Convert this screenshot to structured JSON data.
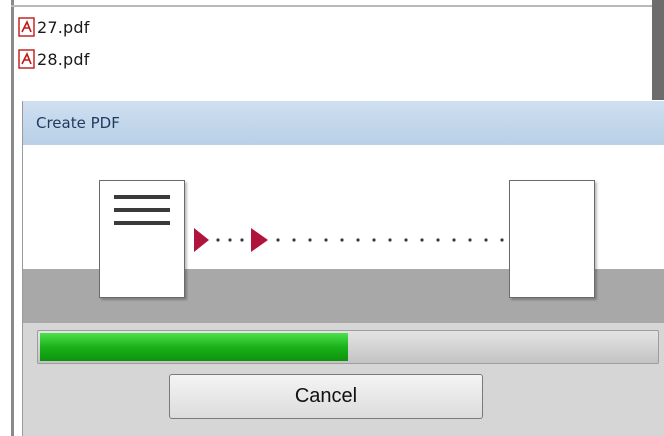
{
  "files": [
    {
      "name": "27.pdf",
      "icon": "pdf-file-icon"
    },
    {
      "name": "28.pdf",
      "icon": "pdf-file-icon"
    }
  ],
  "dialog": {
    "title": "Create PDF",
    "progress": 0.5,
    "cancel_label": "Cancel"
  },
  "colors": {
    "title_bar": "#c4d7ec",
    "progress_green": "#1bb21b",
    "arrow_red": "#b0143c",
    "pdf_red": "#c01818"
  }
}
